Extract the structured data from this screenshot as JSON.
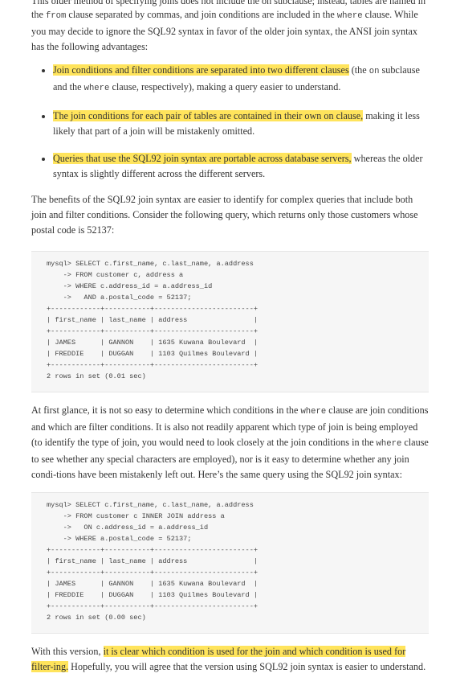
{
  "top_line": "This older method of specifying joins does not include the on subclause; instead, tables are named in",
  "intro": {
    "t1": "the ",
    "c1": "from",
    "t2": " clause separated by commas, and join conditions are included in the ",
    "c2": "where",
    "t3": " clause. While you may decide to ignore the SQL92 syntax in favor of the older join syntax, the ANSI join syntax has the following advantages:"
  },
  "bullets": [
    {
      "hl": "Join conditions and filter conditions are separated into two different clauses",
      "t1": " (the ",
      "c1": "on",
      "t2": " subclause and the ",
      "c2": "where",
      "t3": " clause, respectively), making a query easier to understand."
    },
    {
      "hl": "The join conditions for each pair of tables are contained in their own on clause,",
      "t1": " making it less likely that part of a join will be mistakenly omitted."
    },
    {
      "hl": "Queries that use the SQL92 join syntax are portable across database servers,",
      "t1": " whereas the older syntax is slightly different across the different servers."
    }
  ],
  "para2": "The benefits of the SQL92 join syntax are easier to identify for complex queries that include both join and filter conditions. Consider the following query, which returns only those customers whose postal code is 52137:",
  "code1": "mysql> SELECT c.first_name, c.last_name, a.address\n    -> FROM customer c, address a\n    -> WHERE c.address_id = a.address_id\n    ->   AND a.postal_code = 52137;\n+------------+-----------+------------------------+\n| first_name | last_name | address                |\n+------------+-----------+------------------------+\n| JAMES      | GANNON    | 1635 Kuwana Boulevard  |\n| FREDDIE    | DUGGAN    | 1103 Quilmes Boulevard |\n+------------+-----------+------------------------+\n2 rows in set (0.01 sec)",
  "para3": {
    "t1": "At first glance, it is not so easy to determine which conditions in the ",
    "c1": "where",
    "t2": " clause are join conditions and which are filter conditions. It is also not readily apparent which type of join is being employed (to identify the type of join, you would need to look closely at the join conditions in the ",
    "c2": "where",
    "t3": " clause to see whether any special characters are employed), nor is it easy to determine whether any join condi-tions have been mistakenly left out. Here’s the same query using the SQL92 join syntax:"
  },
  "code2": "mysql> SELECT c.first_name, c.last_name, a.address\n    -> FROM customer c INNER JOIN address a\n    ->   ON c.address_id = a.address_id\n    -> WHERE a.postal_code = 52137;\n+------------+-----------+------------------------+\n| first_name | last_name | address                |\n+------------+-----------+------------------------+\n| JAMES      | GANNON    | 1635 Kuwana Boulevard  |\n| FREDDIE    | DUGGAN    | 1103 Quilmes Boulevard |\n+------------+-----------+------------------------+\n2 rows in set (0.00 sec)",
  "para4": {
    "t1": "With this version, ",
    "hl": "it is clear which condition is used for the join and which condition is used for filter-ing.",
    "t2": " Hopefully, you will agree that the version using SQL92 join syntax is easier to understand."
  },
  "highlight_color": "#ffe45c"
}
